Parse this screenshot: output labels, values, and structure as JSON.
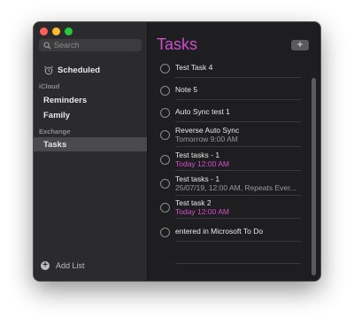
{
  "sidebar": {
    "search_placeholder": "Search",
    "scheduled": "Scheduled",
    "icloud_header": "iCloud",
    "reminders": "Reminders",
    "family": "Family",
    "exchange_header": "Exchange",
    "tasks": "Tasks",
    "add_list": "Add List"
  },
  "main": {
    "title": "Tasks",
    "add_button": "+",
    "tasks": [
      {
        "title": "Test Task 4"
      },
      {
        "title": "Note 5"
      },
      {
        "title": "Auto Sync test 1"
      },
      {
        "title": "Reverse Auto Sync",
        "subtitle": "Tomorrow 9:00 AM"
      },
      {
        "title": "Test tasks - 1",
        "subtitle": "Today 12:00 AM"
      },
      {
        "title": "Test tasks - 1",
        "subtitle": "25/07/19, 12:00 AM, Repeats Ever..."
      },
      {
        "title": "Test task 2",
        "subtitle": "Today 12:00 AM"
      },
      {
        "title": "entered in Microsoft To Do"
      }
    ]
  },
  "colors": {
    "accent": "#cf4fcc",
    "close": "#fe5f57",
    "minimize": "#febc2e",
    "zoom": "#28c840"
  }
}
